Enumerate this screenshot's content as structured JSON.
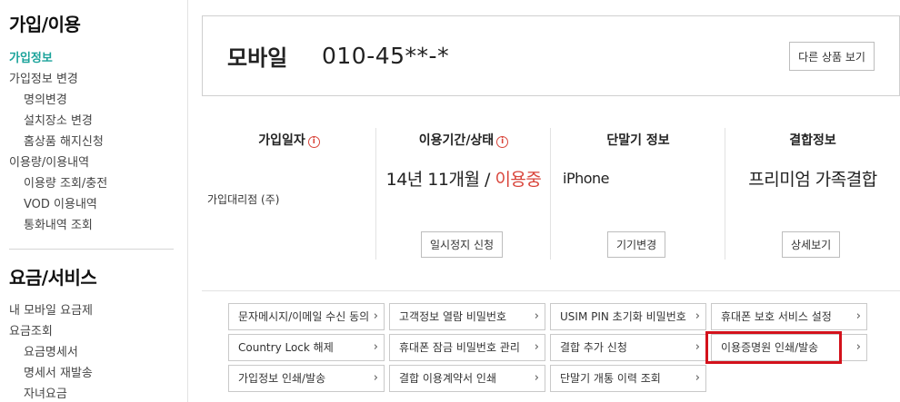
{
  "sidebar": {
    "heading1": "가입/이용",
    "items1": [
      {
        "label": "가입정보",
        "level": 1,
        "active": true
      },
      {
        "label": "가입정보 변경",
        "level": 1
      },
      {
        "label": "명의변경",
        "level": 2
      },
      {
        "label": "설치장소 변경",
        "level": 2
      },
      {
        "label": "홈상품 해지신청",
        "level": 2
      },
      {
        "label": "이용량/이용내역",
        "level": 1
      },
      {
        "label": "이용량 조회/충전",
        "level": 2
      },
      {
        "label": "VOD 이용내역",
        "level": 2
      },
      {
        "label": "통화내역 조회",
        "level": 2
      }
    ],
    "heading2": "요금/서비스",
    "items2": [
      {
        "label": "내 모바일 요금제",
        "level": 1
      },
      {
        "label": "요금조회",
        "level": 1
      },
      {
        "label": "요금명세서",
        "level": 2
      },
      {
        "label": "명세서 재발송",
        "level": 2
      },
      {
        "label": "자녀요금",
        "level": 2
      }
    ]
  },
  "header": {
    "title": "모바일",
    "phone": "010-45**-*",
    "other_products_button": "다른 상품 보기"
  },
  "info": {
    "join_date": {
      "heading": "가입일자",
      "info_icon": "i",
      "sub": "가입대리점 (주)"
    },
    "period": {
      "heading": "이용기간/상태",
      "info_icon": "i",
      "duration": "14년 11개월",
      "slash": " / ",
      "status": "이용중",
      "button": "일시정지 신청"
    },
    "device": {
      "heading": "단말기 정보",
      "model": "iPhone",
      "button": "기기변경"
    },
    "bundle": {
      "heading": "결합정보",
      "value": "프리미엄 가족결합",
      "button": "상세보기"
    }
  },
  "links": [
    {
      "label": "문자메시지/이메일 수신 동의"
    },
    {
      "label": "고객정보 열람 비밀번호"
    },
    {
      "label": "USIM PIN 초기화 비밀번호"
    },
    {
      "label": "휴대폰 보호 서비스 설정"
    },
    {
      "label": "Country Lock 해제"
    },
    {
      "label": "휴대폰 잠금 비밀번호 관리"
    },
    {
      "label": "결합 추가 신청"
    },
    {
      "label": "이용증명원 인쇄/발송",
      "highlighted": true
    },
    {
      "label": "가입정보 인쇄/발송"
    },
    {
      "label": "결합 이용계약서 인쇄"
    },
    {
      "label": "단말기 개통 이력 조회"
    }
  ],
  "arrow_glyph": "›",
  "colors": {
    "accent": "#1aa39a",
    "status_red": "#d9453b",
    "highlight": "#d3111b"
  }
}
